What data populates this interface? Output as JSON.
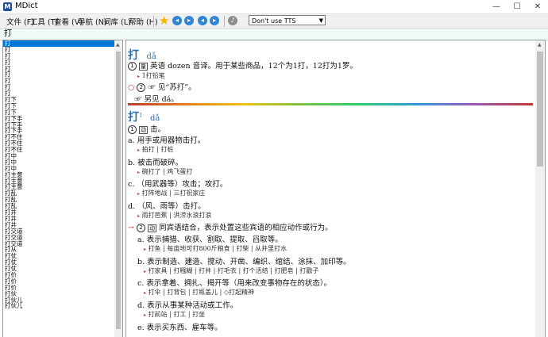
{
  "window": {
    "title": "MDict",
    "minimize": "—",
    "maximize": "☐",
    "close": "✕"
  },
  "menu": [
    "文件 (F)",
    "工具 (T)",
    "查看 (V)",
    "导航 (N)",
    "词库 (L)",
    "帮助 (H)"
  ],
  "toolbar": {
    "tts_option": "Don't use TTS",
    "icons": [
      "star-icon",
      "back-icon",
      "forward-icon",
      "prev-icon",
      "next-icon",
      "speaker-icon"
    ]
  },
  "search": {
    "value": "打"
  },
  "word_list": [
    "打",
    "打",
    "打",
    "打",
    "打",
    "打",
    "打",
    "打",
    "打",
    "打下",
    "打下",
    "打下",
    "打下手",
    "打下手",
    "打下手",
    "打不住",
    "打不住",
    "打不住",
    "打中",
    "打中",
    "打中",
    "打主意",
    "打主意",
    "打主意",
    "打乱",
    "打乱",
    "打乱",
    "打井",
    "打井",
    "打井",
    "打交道",
    "打交道",
    "打交道",
    "打从",
    "打仗",
    "打仗",
    "打仗",
    "打价",
    "打价",
    "打价",
    "打伙",
    "打伙儿",
    "打伙儿"
  ],
  "entry1": {
    "head": "打",
    "pinyin": "dǎ",
    "num1": "1",
    "tag1": "量",
    "def1": "英语 dozen 音译。用于某些商品，12个为1打，12打为1罗。",
    "ex1": "1打铅笔",
    "num2": "2",
    "see": "见“苏打”。",
    "also": "另见 dá。"
  },
  "entry2": {
    "head": "打",
    "sup": "1",
    "pinyin": "dǎ",
    "sense1_num": "1",
    "sense1_tag": "动",
    "sense1_def": "击。",
    "a": "a. 用手或用器物击打。",
    "a_ex": "拍打 | 打桩",
    "b": "b. 被击而破碎。",
    "b_ex": "碗打了 | 鸡飞蛋打",
    "c": "c. （用武器等）攻击；攻打。",
    "c_ex": "打阵地战 | 三打祝家庄",
    "d": "d. （风、雨等）击打。",
    "d_ex": "雨打芭蕉 | 洪涝水浪打浪",
    "sense2_num": "2",
    "sense2_tag": "动",
    "sense2_def": "同宾语结合，表示处置这些宾语的相应动作或行为。",
    "s2a": "a. 表示捕猎、收获、割取、提取、舀取等。",
    "s2a_ex": "打鱼 | 每亩地可打800斤粮食 | 打柴 | 从井里打水",
    "s2b": "b. 表示制造、建造、搅动、开凿、编织、绾结、涂抹、加印等。",
    "s2b_ex": "打家具 | 打糨糊 | 打井 | 打毛衣 | 打个活结 | 打肥皂 | 打戳子",
    "s2c": "c. 表示拿着、拥扎、揭开等（用来改变事物存在的状态）。",
    "s2c_ex": "打伞 | 打背包 | 打瓶盖儿 | ◇打起精神",
    "s2d": "d. 表示从事某种活动或工作。",
    "s2d_ex": "打前站 | 打工 | 打坐",
    "s2e": "e. 表示买东西、雇车等。"
  }
}
